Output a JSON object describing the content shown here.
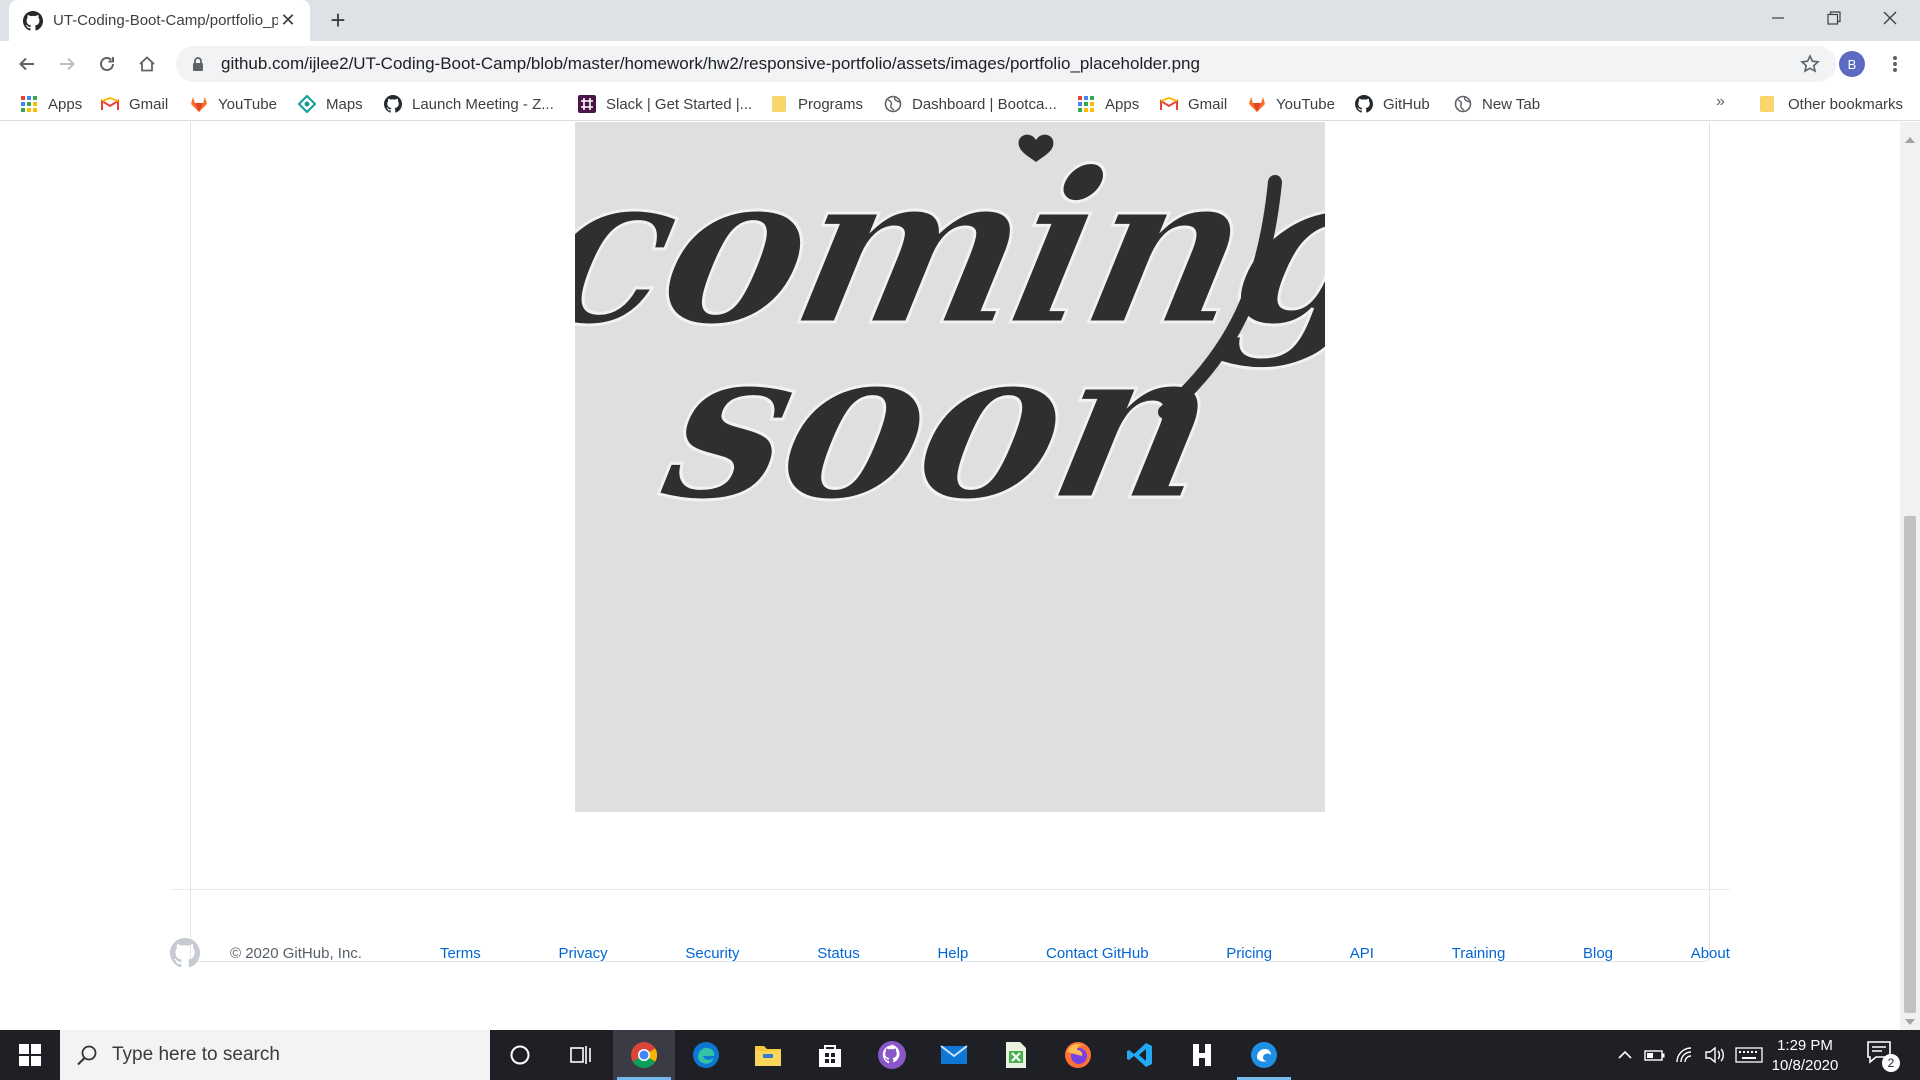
{
  "browser": {
    "tab": {
      "title": "UT-Coding-Boot-Camp/portfolio_placeholder.png at master",
      "close_symbol": "✕"
    },
    "new_tab_symbol": "+",
    "address_bar": {
      "url": "github.com/ijlee2/UT-Coding-Boot-Camp/blob/master/homework/hw2/responsive-portfolio/assets/images/portfolio_placeholder.png"
    },
    "profile_initial": "B",
    "bookmarks": [
      {
        "label": "Apps",
        "icon": "apps-grid-icon"
      },
      {
        "label": "Gmail",
        "icon": "gmail-icon"
      },
      {
        "label": "YouTube",
        "icon": "gitlab-fox-icon"
      },
      {
        "label": "Maps",
        "icon": "maps-icon"
      },
      {
        "label": "Launch Meeting - Z...",
        "icon": "github-icon"
      },
      {
        "label": "Slack | Get Started |...",
        "icon": "slack-icon"
      },
      {
        "label": "Programs",
        "icon": "folder-icon"
      },
      {
        "label": "Dashboard | Bootca...",
        "icon": "globe-icon"
      },
      {
        "label": "Apps",
        "icon": "apps-grid-icon"
      },
      {
        "label": "Gmail",
        "icon": "gmail-icon"
      },
      {
        "label": "YouTube",
        "icon": "gitlab-fox-icon"
      },
      {
        "label": "GitHub",
        "icon": "github-icon"
      },
      {
        "label": "New Tab",
        "icon": "globe-icon"
      }
    ],
    "bookmarks_overflow": "»",
    "other_bookmarks": "Other bookmarks"
  },
  "image": {
    "line1": "coming",
    "line2": "soon"
  },
  "footer": {
    "copyright": "© 2020 GitHub, Inc.",
    "links": [
      "Terms",
      "Privacy",
      "Security",
      "Status",
      "Help",
      "Contact GitHub",
      "Pricing",
      "API",
      "Training",
      "Blog",
      "About"
    ]
  },
  "taskbar": {
    "search_placeholder": "Type here to search",
    "time": "1:29 PM",
    "date": "10/8/2020",
    "notification_count": "2",
    "apps": [
      "cortana",
      "task-view",
      "chrome",
      "edge",
      "file-explorer",
      "store",
      "github-desktop",
      "mail",
      "excel-like",
      "firefox",
      "vscode",
      "h-app",
      "blue-app"
    ]
  },
  "colors": {
    "link": "#0366d6",
    "taskbar": "#1f1f26",
    "image_bg": "#dfdfdf",
    "lettering": "#2f2f2f"
  }
}
